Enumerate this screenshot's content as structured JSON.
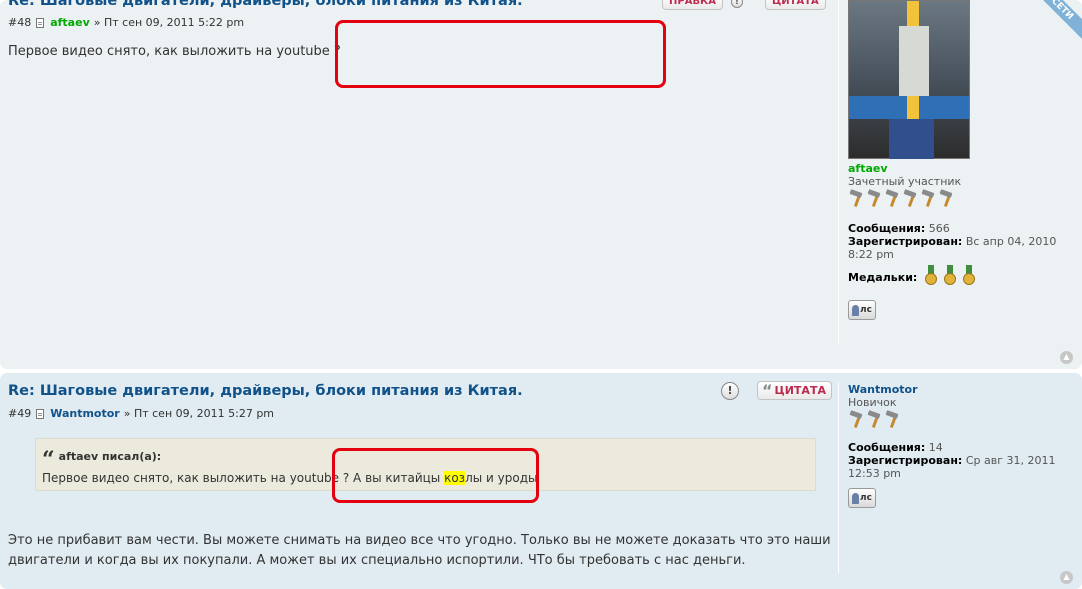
{
  "colors": {
    "post_bg_odd": "#ecf1f3",
    "post_bg_even": "#e1ebf2",
    "title": "#105289",
    "user_green": "#00aa00",
    "user_blue": "#105289",
    "annotation": "#e3000f",
    "highlight": "#ffff00"
  },
  "ribbon": {
    "text": "СЕТИ"
  },
  "posts": [
    {
      "title": "Re: Шаговые двигатели, драйверы, блоки питания из Китая.",
      "number": "#48",
      "author": "aftaev",
      "date": "» Пт сен 09, 2011 5:22 pm",
      "edit_label": "ПРАВКА",
      "quote_label": "ЦИТАТА",
      "content": "Первое видео снято, как выложить на youtube ?",
      "profile": {
        "username": "aftaev",
        "rank": "Зачетный участник",
        "posts_label": "Сообщения:",
        "posts_value": "566",
        "registered_label": "Зарегистрирован:",
        "registered_value": "Вс апр 04, 2010 8:22 pm",
        "medals_label": "Медальки:",
        "pm_label": "лс"
      }
    },
    {
      "title": "Re: Шаговые двигатели, драйверы, блоки питания из Китая.",
      "number": "#49",
      "author": "Wantmotor",
      "date": "» Пт сен 09, 2011 5:27 pm",
      "warn_label": "!",
      "quote_label": "ЦИТАТА",
      "quote": {
        "cite": "aftaev писал(а):",
        "text_before": "Первое видео снято, как выложить на youtube ? А вы китайцы ",
        "text_highlight": "коз",
        "text_after": "лы и уроды"
      },
      "content_line1": "Это не прибавит вам чести. Вы можете снимать на видео все что угодно. Только вы не можете доказать что это наши",
      "content_line2": "двигатели и когда вы их покупали. А может вы их специально испортили. ЧТо бы требовать с нас деньги.",
      "profile": {
        "username": "Wantmotor",
        "rank": "Новичок",
        "posts_label": "Сообщения:",
        "posts_value": "14",
        "registered_label": "Зарегистрирован:",
        "registered_value": "Ср авг 31, 2011 12:53 pm",
        "pm_label": "лс"
      }
    }
  ]
}
